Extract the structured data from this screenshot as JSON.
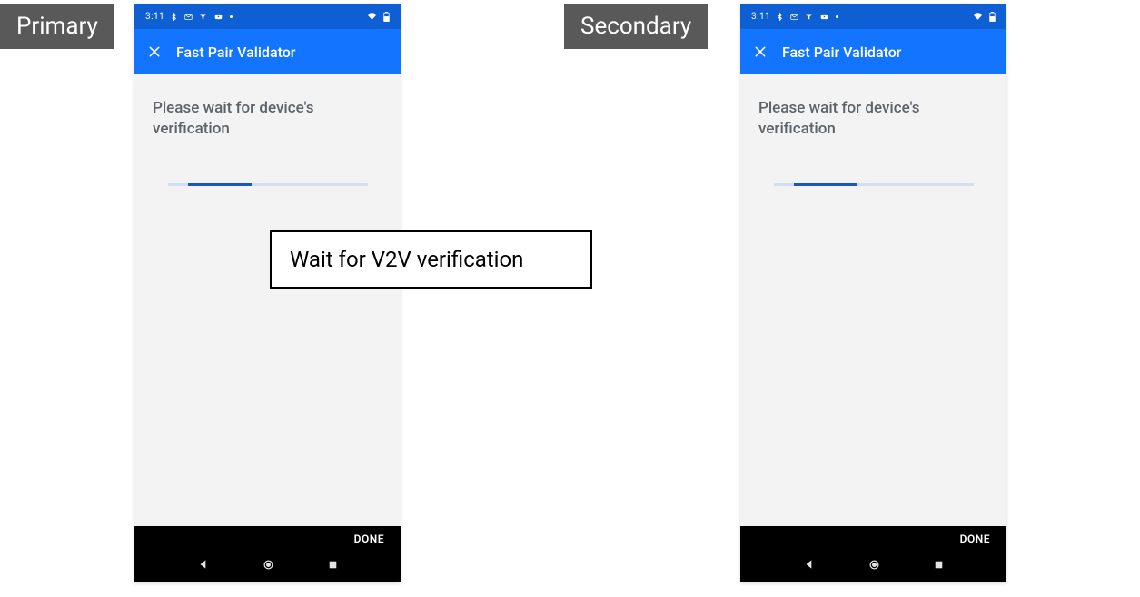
{
  "labels": {
    "primary": "Primary",
    "secondary": "Secondary"
  },
  "callout": {
    "text": "Wait for V2V verification"
  },
  "phone": {
    "status_time": "3:11",
    "app_title": "Fast Pair Validator",
    "wait_message": "Please wait for device's verification",
    "done_label": "DONE"
  }
}
